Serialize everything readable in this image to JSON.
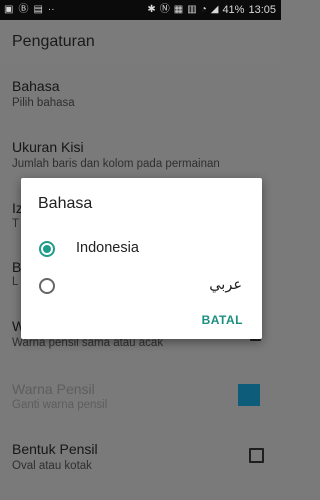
{
  "status_bar": {
    "left_icons": [
      "image-icon",
      "bookmark-icon",
      "gallery-icon",
      "more-dots-icon"
    ],
    "right_icons": [
      "bluetooth-icon",
      "nfc-icon",
      "data-icon",
      "sim-icon",
      "wifi-icon",
      "signal-icon"
    ],
    "battery": "41%",
    "time": "13:05"
  },
  "app_bar": {
    "title": "Pengaturan"
  },
  "settings": {
    "items": [
      {
        "title": "Bahasa",
        "subtitle": "Pilih bahasa"
      },
      {
        "title": "Ukuran Kisi",
        "subtitle": "Jumlah baris dan kolom pada permainan"
      },
      {
        "title": "Iz",
        "subtitle": "T"
      },
      {
        "title": "B",
        "subtitle": "L"
      },
      {
        "title": "W",
        "subtitle": "Warna pensil sama atau acak"
      },
      {
        "title": "Warna Pensil",
        "subtitle": "Ganti warna pensil",
        "disabled": true,
        "color": "#0d5c7a"
      },
      {
        "title": "Bentuk Pensil",
        "subtitle": "Oval atau kotak"
      }
    ]
  },
  "dialog": {
    "title": "Bahasa",
    "options": [
      {
        "label": "Indonesia",
        "selected": true
      },
      {
        "label": "عربي",
        "selected": false
      }
    ],
    "cancel_label": "BATAL",
    "accent": "#1f9c8a"
  }
}
